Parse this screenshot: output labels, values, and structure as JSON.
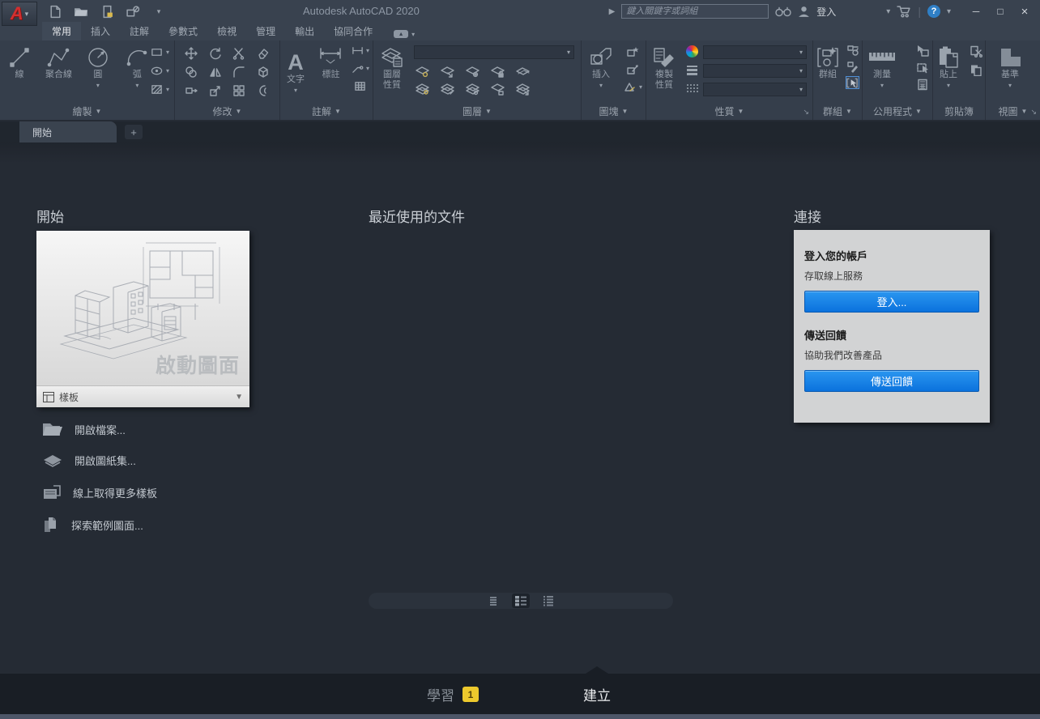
{
  "glyphs": {
    "caret_down": "▾",
    "dropdown": "▼",
    "caret_right": "▶",
    "dialog_launcher": "↘",
    "plus": "+",
    "minimize": "─",
    "maximize": "□",
    "close": "×",
    "help": "?",
    "divider": "|",
    "ribbon_toggle": "▲",
    "text_tool_glyph": "A"
  },
  "title_bar": {
    "app_title": "Autodesk AutoCAD 2020",
    "search_placeholder": "鍵入關鍵字或詞組",
    "sign_in_label": "登入",
    "icons": [
      "search-arrow",
      "binoculars-icon",
      "user-icon",
      "cart-icon",
      "help-icon"
    ]
  },
  "quick_access": {
    "icons": [
      "new-file-icon",
      "open-folder-icon",
      "save-icon",
      "plot-icon",
      "customize-caret"
    ]
  },
  "ribbon": {
    "tabs": [
      {
        "label": "常用",
        "active": true
      },
      {
        "label": "插入",
        "active": false
      },
      {
        "label": "註解",
        "active": false
      },
      {
        "label": "參數式",
        "active": false
      },
      {
        "label": "檢視",
        "active": false
      },
      {
        "label": "管理",
        "active": false
      },
      {
        "label": "輸出",
        "active": false
      },
      {
        "label": "協同合作",
        "active": false
      }
    ],
    "panels": [
      {
        "label": "繪製",
        "tools": [
          "線",
          "聚合線",
          "圓",
          "弧"
        ]
      },
      {
        "label": "修改",
        "tools": []
      },
      {
        "label": "註解",
        "tools": [
          "文字",
          "標註"
        ]
      },
      {
        "label": "圖層",
        "tools": [
          "圖層性質"
        ]
      },
      {
        "label": "圖塊",
        "tools": [
          "插入"
        ]
      },
      {
        "label": "性質",
        "tools": [
          "複製性質"
        ]
      },
      {
        "label": "群組",
        "tools": [
          "群組"
        ]
      },
      {
        "label": "公用程式",
        "tools": [
          "測量"
        ]
      },
      {
        "label": "剪貼簿",
        "tools": [
          "貼上"
        ]
      },
      {
        "label": "視圖",
        "tools": [
          "基準"
        ]
      }
    ]
  },
  "file_tabs": {
    "start_tab_label": "開始",
    "new_tab_label": "+"
  },
  "start": {
    "heading": "開始",
    "card_caption": "啟動圖面",
    "template_label": "樣板",
    "links": [
      {
        "label": "開啟檔案...",
        "icon": "open-file-icon"
      },
      {
        "label": "開啟圖紙集...",
        "icon": "sheet-set-icon"
      },
      {
        "label": "線上取得更多樣板",
        "icon": "online-templates-icon"
      },
      {
        "label": "探索範例圖面...",
        "icon": "sample-drawings-icon"
      }
    ]
  },
  "recent": {
    "heading": "最近使用的文件",
    "view_toggles": [
      "thumbnail-view",
      "thumbnail-text-view",
      "list-view"
    ],
    "active_view": "thumbnail-text-view"
  },
  "connect": {
    "heading": "連接",
    "sign_in_title": "登入您的帳戶",
    "sign_in_description": "存取線上服務",
    "sign_in_button": "登入...",
    "feedback_title": "傳送回饋",
    "feedback_description": "協助我們改善產品",
    "feedback_button": "傳送回饋"
  },
  "footer": {
    "learn_label": "學習",
    "learn_badge": "1",
    "create_label": "建立"
  },
  "colors": {
    "accent_blue": "#0d79e0",
    "badge_yellow": "#edc92d",
    "titlebar": "#39424f",
    "ribbon": "#353e4b",
    "content": "#252b34",
    "footer": "#191e25",
    "bottom_strip": "#4d5668",
    "icon_gray": "#9aa3ad",
    "logo_red": "#d32f2f"
  }
}
